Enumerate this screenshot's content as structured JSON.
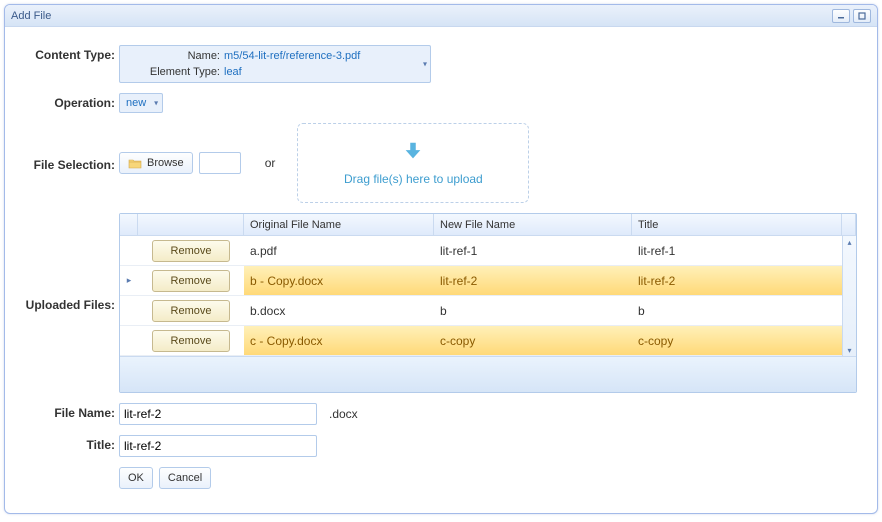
{
  "window": {
    "title": "Add File"
  },
  "labels": {
    "content_type": "Content Type:",
    "operation": "Operation:",
    "file_selection": "File Selection:",
    "uploaded_files": "Uploaded Files:",
    "file_name": "File Name:",
    "title": "Title:"
  },
  "content_type": {
    "name_label": "Name:",
    "name_value": "m5/54-lit-ref/reference-3.pdf",
    "element_type_label": "Element Type:",
    "element_type_value": "leaf"
  },
  "operation": {
    "value": "new"
  },
  "file_selection": {
    "browse_label": "Browse",
    "or_label": "or",
    "dropzone_text": "Drag file(s) here to upload"
  },
  "uploaded": {
    "columns": {
      "action": "",
      "original": "Original File Name",
      "newname": "New File Name",
      "title": "Title"
    },
    "remove_label": "Remove",
    "rows": [
      {
        "original": "a.pdf",
        "newname": "lit-ref-1",
        "title": "lit-ref-1",
        "highlight": false,
        "selected": false
      },
      {
        "original": "b - Copy.docx",
        "newname": "lit-ref-2",
        "title": "lit-ref-2",
        "highlight": true,
        "selected": true
      },
      {
        "original": "b.docx",
        "newname": "b",
        "title": "b",
        "highlight": false,
        "selected": false
      },
      {
        "original": "c - Copy.docx",
        "newname": "c-copy",
        "title": "c-copy",
        "highlight": true,
        "selected": false
      }
    ]
  },
  "inputs": {
    "file_name": "lit-ref-2",
    "file_ext": ".docx",
    "title": "lit-ref-2"
  },
  "buttons": {
    "ok": "OK",
    "cancel": "Cancel"
  }
}
